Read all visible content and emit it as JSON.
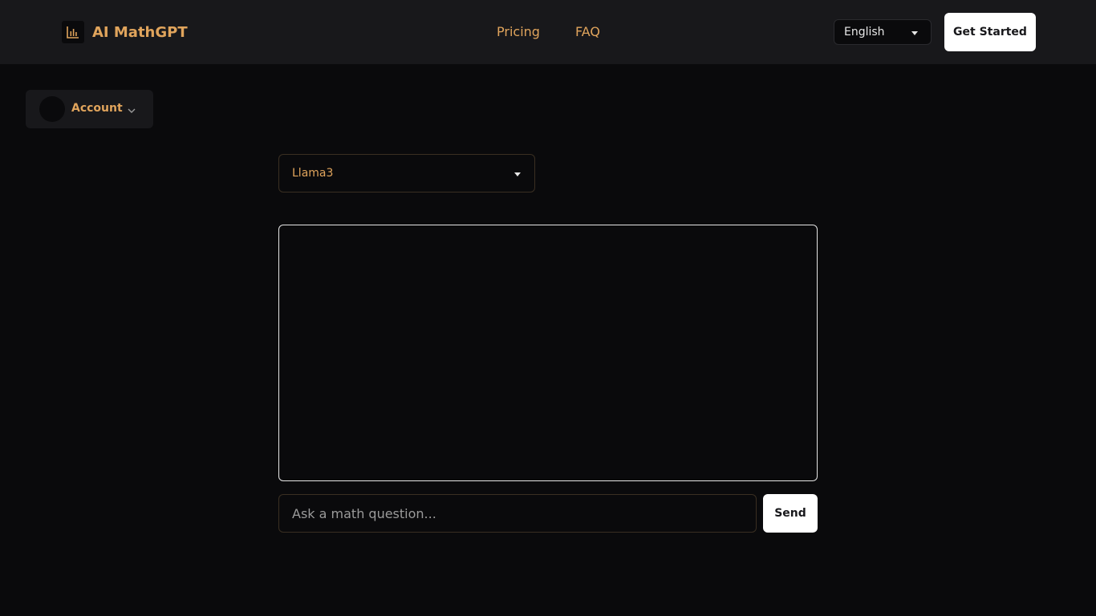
{
  "header": {
    "app_name": "AI MathGPT",
    "logo_icon": "bar-chart-icon",
    "nav": [
      {
        "label": "Pricing"
      },
      {
        "label": "FAQ"
      }
    ],
    "language": {
      "selected": "English"
    },
    "get_started_label": "Get Started"
  },
  "account": {
    "label": "Account"
  },
  "model_select": {
    "selected": "Llama3"
  },
  "chat": {
    "input_placeholder": "Ask a math question...",
    "input_value": "",
    "send_label": "Send"
  },
  "colors": {
    "accent": "#e0a45c",
    "background": "#0a0a0c",
    "header_bg": "#18181b",
    "button_bg": "#ffffff"
  }
}
